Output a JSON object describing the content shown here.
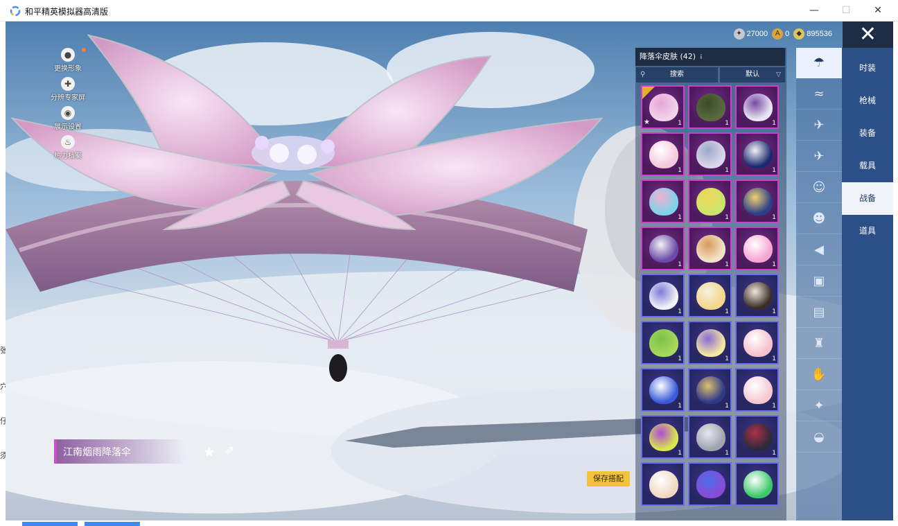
{
  "window": {
    "title": "和平精英模拟器高清版"
  },
  "left_edge": {
    "chars": [
      "张",
      "穴",
      "仔",
      "须"
    ]
  },
  "side_controls": [
    {
      "label": "更换形象",
      "icon": "avatar-icon"
    },
    {
      "label": "分辨专家屏",
      "icon": "puzzle-icon"
    },
    {
      "label": "展示设置",
      "icon": "eye-icon"
    },
    {
      "label": "热力档案",
      "icon": "flame-icon"
    }
  ],
  "currency": [
    {
      "icon": "silver-coin-icon",
      "value": "27000",
      "color": "#c8c8d0"
    },
    {
      "icon": "ag-coin-icon",
      "value": "0",
      "color": "#d9a63a"
    },
    {
      "icon": "uc-coin-icon",
      "value": "895536",
      "color": "#e3c45a"
    }
  ],
  "panel": {
    "header": "降落伞皮肤 (42)",
    "info_mark": "i",
    "search_label": "搜索",
    "sort_label": "默认"
  },
  "skins": [
    {
      "rarity": "pink",
      "colors": [
        "#f2d2ea",
        "#e7a6d8"
      ],
      "qty": "1",
      "selected": true
    },
    {
      "rarity": "pink",
      "colors": [
        "#5a6a3e",
        "#3c4a2a"
      ],
      "qty": "1"
    },
    {
      "rarity": "pink",
      "colors": [
        "#e9e6f5",
        "#7a4aa3"
      ],
      "qty": "1"
    },
    {
      "rarity": "pink",
      "colors": [
        "#f4c8dc",
        "#ffffff"
      ],
      "qty": "1"
    },
    {
      "rarity": "pink",
      "colors": [
        "#dcd6ea",
        "#9aa8c8"
      ],
      "qty": "1"
    },
    {
      "rarity": "pink",
      "colors": [
        "#1b2a70",
        "#f2f2f2"
      ],
      "qty": "1"
    },
    {
      "rarity": "pink",
      "colors": [
        "#7ed3ea",
        "#f0b1d2"
      ],
      "qty": "1"
    },
    {
      "rarity": "pink",
      "colors": [
        "#c9e56a",
        "#f0d65a"
      ],
      "qty": "1"
    },
    {
      "rarity": "pink",
      "colors": [
        "#2c3e8a",
        "#f0d070"
      ],
      "qty": "1"
    },
    {
      "rarity": "pink",
      "colors": [
        "#6a4aa8",
        "#f2f2f2"
      ],
      "qty": "1"
    },
    {
      "rarity": "pink",
      "colors": [
        "#f3e2c8",
        "#d89a5a"
      ],
      "qty": "1"
    },
    {
      "rarity": "pink",
      "colors": [
        "#f6a4d4",
        "#ffffff"
      ],
      "qty": "1"
    },
    {
      "rarity": "blue",
      "colors": [
        "#f2f2f8",
        "#7f7bd8"
      ],
      "qty": "1"
    },
    {
      "rarity": "blue",
      "colors": [
        "#f5d68a",
        "#f5f0e0"
      ],
      "qty": "1"
    },
    {
      "rarity": "blue",
      "colors": [
        "#3a2c28",
        "#f0e6da"
      ],
      "qty": "1"
    },
    {
      "rarity": "blue",
      "colors": [
        "#a6d85a",
        "#7cc24a"
      ],
      "qty": "1"
    },
    {
      "rarity": "blue",
      "colors": [
        "#f5e6a0",
        "#8a6ad8"
      ],
      "qty": "1"
    },
    {
      "rarity": "blue",
      "colors": [
        "#f5c0cc",
        "#ffffff"
      ],
      "qty": "1"
    },
    {
      "rarity": "blue",
      "colors": [
        "#3a5ad8",
        "#ffffff"
      ],
      "qty": "1"
    },
    {
      "rarity": "blue",
      "colors": [
        "#2e3a88",
        "#e0c070"
      ],
      "qty": "1"
    },
    {
      "rarity": "blue",
      "colors": [
        "#f5c8d2",
        "#ffffff"
      ],
      "qty": "1"
    },
    {
      "rarity": "blue",
      "colors": [
        "#d8e84a",
        "#b04ad8"
      ],
      "qty": "1"
    },
    {
      "rarity": "blue",
      "colors": [
        "#9ea4b0",
        "#e8e8ee"
      ],
      "qty": "1"
    },
    {
      "rarity": "blue",
      "colors": [
        "#2a2a3a",
        "#b0304a"
      ],
      "qty": "1"
    },
    {
      "rarity": "blue",
      "colors": [
        "#f0d8c0",
        "#ffffff"
      ],
      "qty": ""
    },
    {
      "rarity": "blue",
      "colors": [
        "#8a4ad8",
        "#4a70e8"
      ],
      "qty": ""
    },
    {
      "rarity": "blue",
      "colors": [
        "#3ac86a",
        "#ffffff"
      ],
      "qty": ""
    }
  ],
  "categories": [
    {
      "icon": "parachute-icon",
      "active": true,
      "glyph": "☂"
    },
    {
      "icon": "wings-icon",
      "glyph": "≈"
    },
    {
      "icon": "drone-icon",
      "glyph": "✈"
    },
    {
      "icon": "plane-icon",
      "glyph": "✈"
    },
    {
      "icon": "emote-face-icon",
      "glyph": "☺"
    },
    {
      "icon": "pet-icon",
      "glyph": "☻"
    },
    {
      "icon": "speaker-icon",
      "glyph": "◀"
    },
    {
      "icon": "tv-icon",
      "glyph": "▣"
    },
    {
      "icon": "photo-icon",
      "glyph": "▤"
    },
    {
      "icon": "fire-extinguisher-icon",
      "glyph": "♜"
    },
    {
      "icon": "hand-sparkle-icon",
      "glyph": "✋"
    },
    {
      "icon": "magic-wand-icon",
      "glyph": "✦"
    },
    {
      "icon": "dish-icon",
      "glyph": "◒"
    }
  ],
  "tabs": [
    {
      "label": "时装"
    },
    {
      "label": "枪械"
    },
    {
      "label": "装备"
    },
    {
      "label": "载具"
    },
    {
      "label": "战备",
      "active": true
    },
    {
      "label": "道具"
    }
  ],
  "selected_item": {
    "name": "江南烟雨降落伞"
  },
  "save_button": "保存搭配"
}
